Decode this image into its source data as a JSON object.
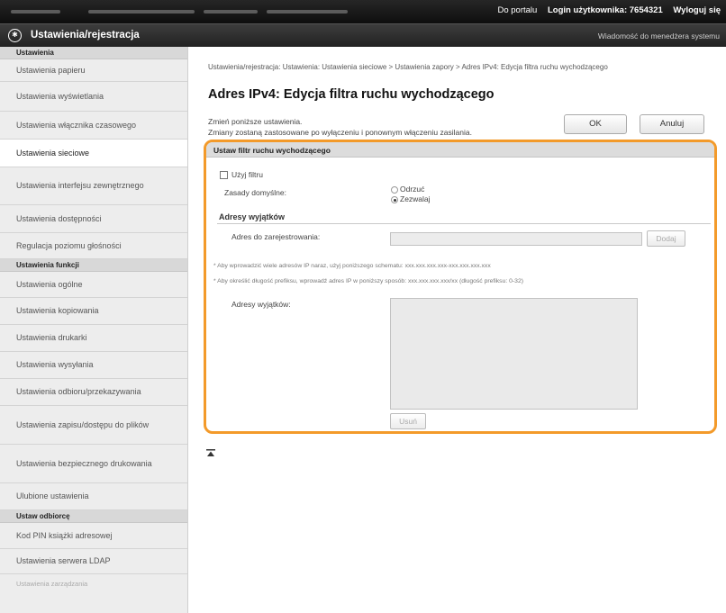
{
  "topbar": {
    "portal_link": "Do portalu",
    "login_label": "Login użytkownika:",
    "login_value": "7654321",
    "logout_link": "Wyloguj się"
  },
  "titlebar": {
    "title": "Ustawienia/rejestracja",
    "message_link": "Wiadomość do menedżera systemu"
  },
  "sidebar": {
    "section_settings": "Ustawienia",
    "items_settings": [
      "Ustawienia papieru",
      "Ustawienia wyświetlania",
      "Ustawienia włącznika czasowego",
      "Ustawienia sieciowe",
      "Ustawienia interfejsu zewnętrznego",
      "Ustawienia dostępności",
      "Regulacja poziomu głośności"
    ],
    "section_functions": "Ustawienia funkcji",
    "items_functions": [
      "Ustawienia ogólne",
      "Ustawienia kopiowania",
      "Ustawienia drukarki",
      "Ustawienia wysyłania",
      "Ustawienia odbioru/przekazywania",
      "Ustawienia zapisu/dostępu do plików",
      "Ustawienia bezpiecznego drukowania",
      "Ulubione ustawienia"
    ],
    "section_receiver": "Ustaw odbiorcę",
    "items_receiver": [
      "Kod PIN książki adresowej",
      "Ustawienia serwera LDAP"
    ],
    "section_management": "Ustawienia zarządzania"
  },
  "main": {
    "breadcrumb": "Ustawienia/rejestracja: Ustawienia: Ustawienia sieciowe > Ustawienia zapory > Adres IPv4: Edycja filtra ruchu wychodzącego",
    "heading": "Adres IPv4: Edycja filtra ruchu wychodzącego",
    "hint_line1": "Zmień poniższe ustawienia.",
    "hint_line2": "Zmiany zostaną zastosowane po wyłączeniu i ponownym włączeniu zasilania.",
    "ok_button": "OK",
    "cancel_button": "Anuluj"
  },
  "panel": {
    "title": "Ustaw filtr ruchu wychodzącego",
    "use_filter_label": "Użyj filtru",
    "use_filter_checked": false,
    "default_policy_label": "Zasady domyślne:",
    "policy_options": [
      "Odrzuć",
      "Zezwalaj"
    ],
    "policy_selected": "Zezwalaj",
    "exceptions_heading": "Adresy wyjątków",
    "register_address_label": "Adres do zarejestrowania:",
    "register_address_value": "",
    "add_button": "Dodaj",
    "note1": "* Aby wprowadzić wiele adresów IP naraz, użyj poniższego schematu: xxx.xxx.xxx.xxx-xxx.xxx.xxx.xxx",
    "note2": "* Aby określić długość prefiksu, wprowadź adres IP w poniższy sposób: xxx.xxx.xxx.xxx/xx (długość prefiksu: 0-32)",
    "exceptions_list_label": "Adresy wyjątków:",
    "exceptions_list": [],
    "delete_button": "Usuń"
  },
  "colors": {
    "highlight_frame": "#f39a2a",
    "topbar_bg": "#111111",
    "sidebar_bg": "#ededed"
  },
  "icons": {
    "logo": "settings-register-logo-icon",
    "back_to_top": "arrow-to-top-icon"
  }
}
